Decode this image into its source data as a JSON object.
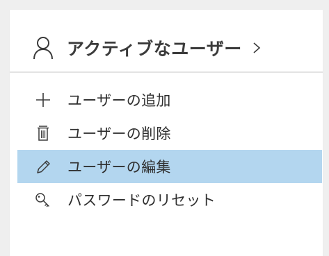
{
  "colors": {
    "background": "#efefef",
    "card": "#ffffff",
    "divider": "#e3e3e3",
    "selected_row": "#b3d6ef",
    "text": "#2f2f2f"
  },
  "header": {
    "icon": "user-icon",
    "title": "アクティブなユーザー",
    "chevron": "chevron-right-icon"
  },
  "menu": {
    "items": [
      {
        "icon": "plus-icon",
        "label": "ユーザーの追加",
        "selected": false
      },
      {
        "icon": "trash-icon",
        "label": "ユーザーの削除",
        "selected": false
      },
      {
        "icon": "pencil-icon",
        "label": "ユーザーの編集",
        "selected": true
      },
      {
        "icon": "key-icon",
        "label": "パスワードのリセット",
        "selected": false
      }
    ]
  }
}
